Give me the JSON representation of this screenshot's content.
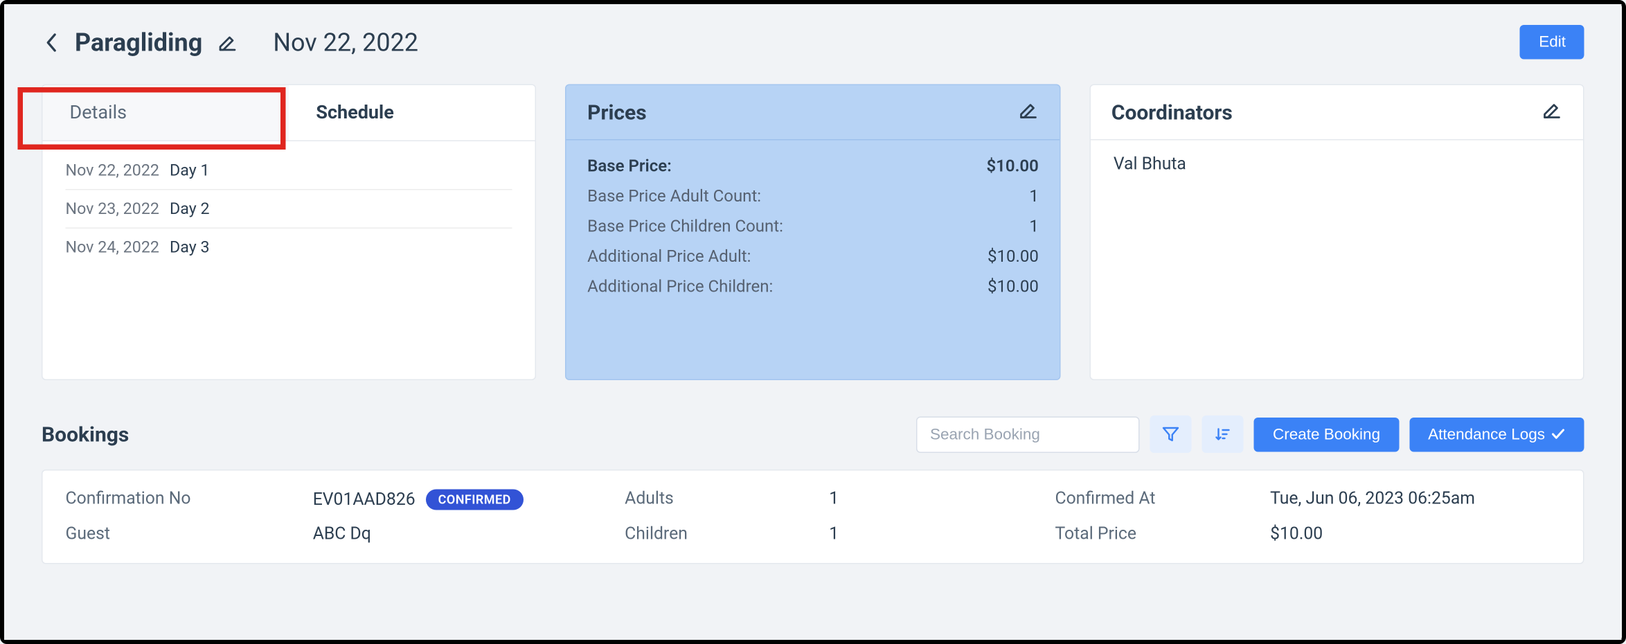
{
  "header": {
    "title": "Paragliding",
    "date": "Nov 22, 2022",
    "edit_label": "Edit"
  },
  "tabs": {
    "details": "Details",
    "schedule": "Schedule"
  },
  "schedule": [
    {
      "date": "Nov 22, 2022",
      "day": "Day 1"
    },
    {
      "date": "Nov 23, 2022",
      "day": "Day 2"
    },
    {
      "date": "Nov 24, 2022",
      "day": "Day 3"
    }
  ],
  "prices": {
    "title": "Prices",
    "rows": [
      {
        "label": "Base Price:",
        "value": "$10.00",
        "strong": true
      },
      {
        "label": "Base Price Adult Count:",
        "value": "1"
      },
      {
        "label": "Base Price Children Count:",
        "value": "1"
      },
      {
        "label": "Additional Price Adult:",
        "value": "$10.00"
      },
      {
        "label": "Additional Price Children:",
        "value": "$10.00"
      }
    ]
  },
  "coordinators": {
    "title": "Coordinators",
    "names": [
      "Val Bhuta"
    ]
  },
  "bookings": {
    "title": "Bookings",
    "search_placeholder": "Search Booking",
    "create_label": "Create Booking",
    "attendance_label": "Attendance Logs",
    "row": {
      "conf_no_label": "Confirmation No",
      "conf_no": "EV01AAD826",
      "status": "CONFIRMED",
      "adults_label": "Adults",
      "adults": "1",
      "confirmed_label": "Confirmed At",
      "confirmed_at": "Tue, Jun 06, 2023 06:25am",
      "guest_label": "Guest",
      "guest": "ABC   Dq",
      "children_label": "Children",
      "children": "1",
      "total_label": "Total Price",
      "total": "$10.00"
    }
  }
}
